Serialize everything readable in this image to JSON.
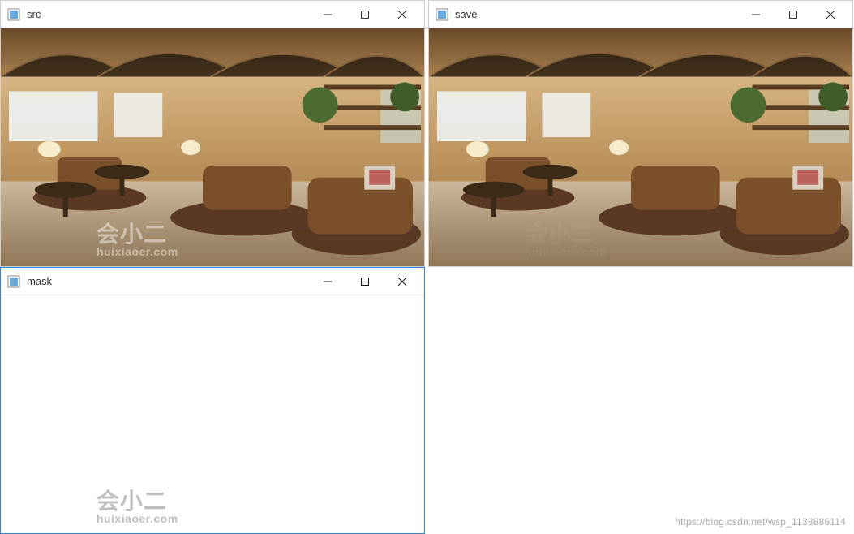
{
  "windows": {
    "src": {
      "title": "src"
    },
    "save": {
      "title": "save"
    },
    "mask": {
      "title": "mask"
    }
  },
  "watermark": {
    "line1": "会小二",
    "line2": "huixiaoer.com"
  },
  "attribution": "https://blog.csdn.net/wsp_1138886114",
  "icons": {
    "app": "app-icon",
    "minimize": "minimize-icon",
    "maximize": "maximize-icon",
    "close": "close-icon"
  }
}
